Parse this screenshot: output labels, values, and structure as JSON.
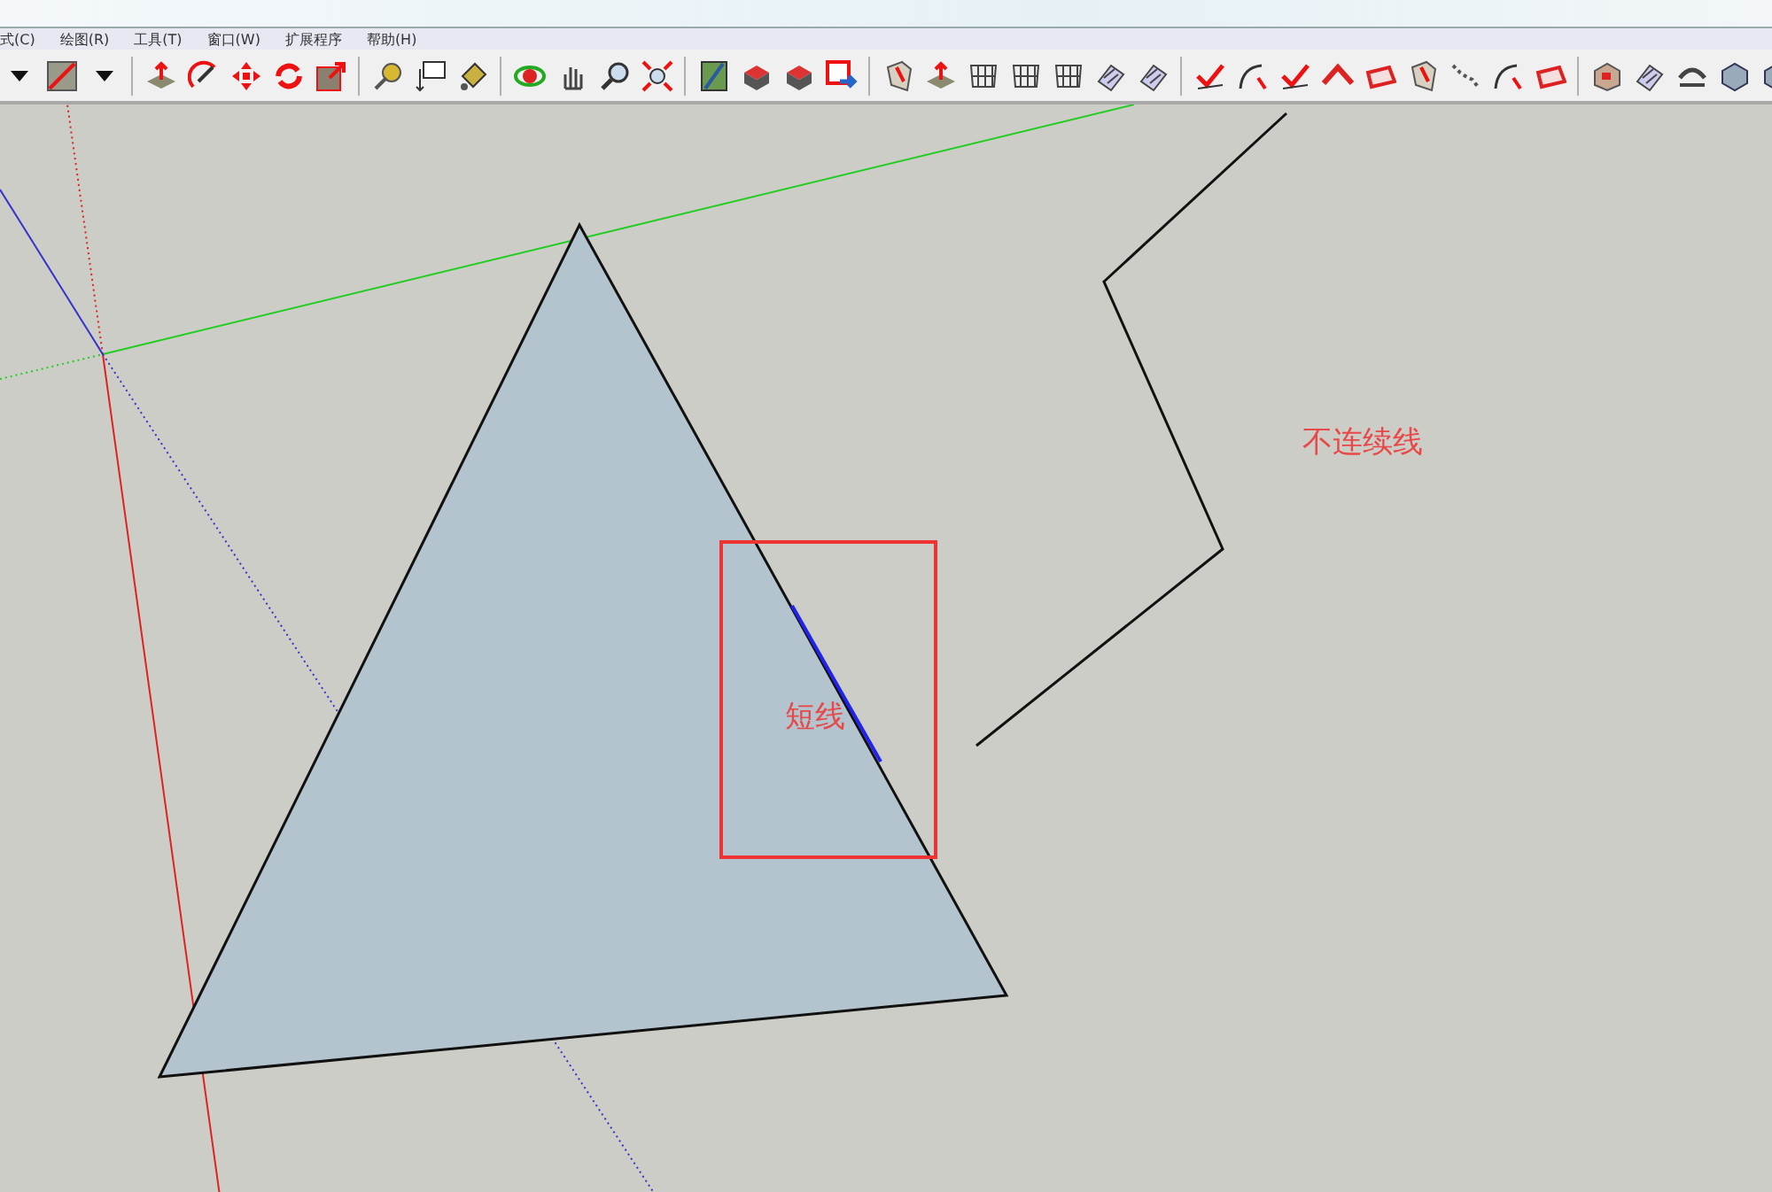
{
  "menu_bar": {
    "items": [
      {
        "label": "式(C)"
      },
      {
        "label": "绘图(R)"
      },
      {
        "label": "工具(T)"
      },
      {
        "label": "窗口(W)"
      },
      {
        "label": "扩展程序"
      },
      {
        "label": "帮助(H)"
      }
    ]
  },
  "canvas": {
    "annotations": [
      {
        "kind": "label",
        "text": "不连续线"
      },
      {
        "kind": "label",
        "text": "短线"
      }
    ]
  }
}
